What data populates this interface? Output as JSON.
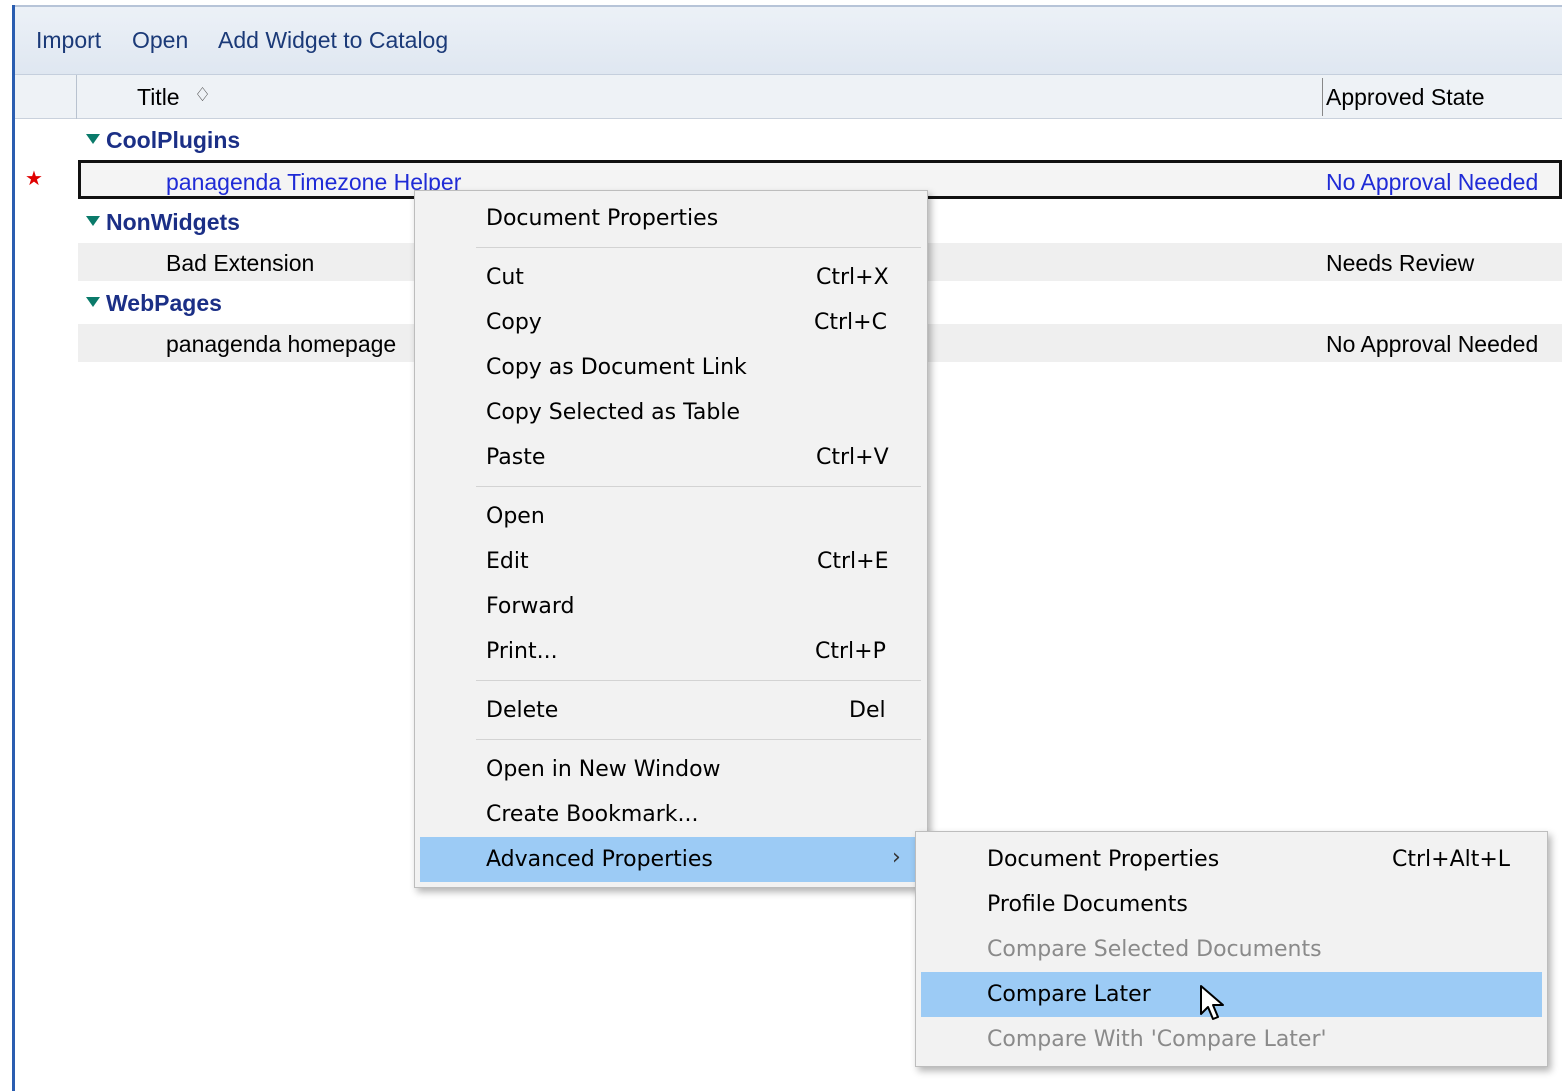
{
  "actions": {
    "import": "Import",
    "open": "Open",
    "add_widget": "Add Widget to Catalog"
  },
  "columns": {
    "title": "Title",
    "approved": "Approved State"
  },
  "categories": [
    {
      "name": "CoolPlugins"
    },
    {
      "name": "NonWidgets"
    },
    {
      "name": "WebPages"
    }
  ],
  "rows": [
    {
      "title": "panagenda Timezone Helper",
      "state": "No Approval Needed"
    },
    {
      "title": "Bad Extension",
      "state": "Needs Review"
    },
    {
      "title": "panagenda homepage",
      "state": "No Approval Needed"
    }
  ],
  "context_menu": {
    "items": [
      {
        "label": "Document Properties",
        "shortcut": ""
      },
      {
        "label": "Cut",
        "shortcut": "Ctrl+X"
      },
      {
        "label": "Copy",
        "shortcut": "Ctrl+C"
      },
      {
        "label": "Copy as Document Link",
        "shortcut": ""
      },
      {
        "label": "Copy Selected as Table",
        "shortcut": ""
      },
      {
        "label": "Paste",
        "shortcut": "Ctrl+V"
      },
      {
        "label": "Open",
        "shortcut": ""
      },
      {
        "label": "Edit",
        "shortcut": "Ctrl+E"
      },
      {
        "label": "Forward",
        "shortcut": ""
      },
      {
        "label": "Print...",
        "shortcut": "Ctrl+P"
      },
      {
        "label": "Delete",
        "shortcut": "Del"
      },
      {
        "label": "Open in New Window",
        "shortcut": ""
      },
      {
        "label": "Create Bookmark...",
        "shortcut": ""
      },
      {
        "label": "Advanced Properties",
        "shortcut": ""
      }
    ]
  },
  "submenu": {
    "items": [
      {
        "label": "Document Properties",
        "shortcut": "Ctrl+Alt+L"
      },
      {
        "label": "Profile Documents",
        "shortcut": ""
      },
      {
        "label": "Compare Selected Documents",
        "shortcut": ""
      },
      {
        "label": "Compare Later",
        "shortcut": ""
      },
      {
        "label": "Compare With 'Compare Later'",
        "shortcut": ""
      }
    ]
  },
  "colors": {
    "highlight": "#9ccbf5",
    "link_blue": "#1f2bd6",
    "category": "#1b2f86",
    "star": "#e00000"
  }
}
